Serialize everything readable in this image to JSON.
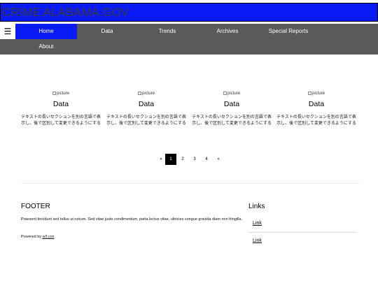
{
  "header": {
    "title": "CRIME ALABAMA.GOV"
  },
  "nav": {
    "menu_icon": "☰",
    "items": [
      {
        "label": "Home"
      },
      {
        "label": "Data"
      },
      {
        "label": "Trends"
      },
      {
        "label": "Archives"
      },
      {
        "label": "Special Reports"
      },
      {
        "label": "About"
      }
    ],
    "active_color": "#0a1af5",
    "bar_color": "#5a5a5a"
  },
  "cards": [
    {
      "image_alt": "picture",
      "title": "Data",
      "text": "テキストの長いセクションを別の言語で表示し、後で区別して変更できるようにする"
    },
    {
      "image_alt": "picture",
      "title": "Data",
      "text": "テキストの長いセクションを別の言語で表示し、後で区別して変更できるようにする"
    },
    {
      "image_alt": "picture",
      "title": "Data",
      "text": "テキストの長いセクションを別の言語で表示し、後で区別して変更できるようにする"
    },
    {
      "image_alt": "picture",
      "title": "Data",
      "text": "テキストの長いセクションを別の言語で表示し、後で区別して変更できるようにする"
    }
  ],
  "pagination": {
    "prev": "«",
    "pages": [
      "1",
      "2",
      "3",
      "4"
    ],
    "next": "»",
    "current": "1"
  },
  "footer": {
    "title": "FOOTER",
    "text": "Praesent tincidunt sed tellus ut rutrum. Sed vitae justo condimentum, porta lectus vitae, ultricies congue gravida diam non fringilla.",
    "powered_prefix": "Powered by ",
    "powered_link": "w3.css"
  },
  "links": {
    "title": "Links",
    "items": [
      {
        "label": "Link"
      },
      {
        "label": "Link"
      }
    ]
  }
}
